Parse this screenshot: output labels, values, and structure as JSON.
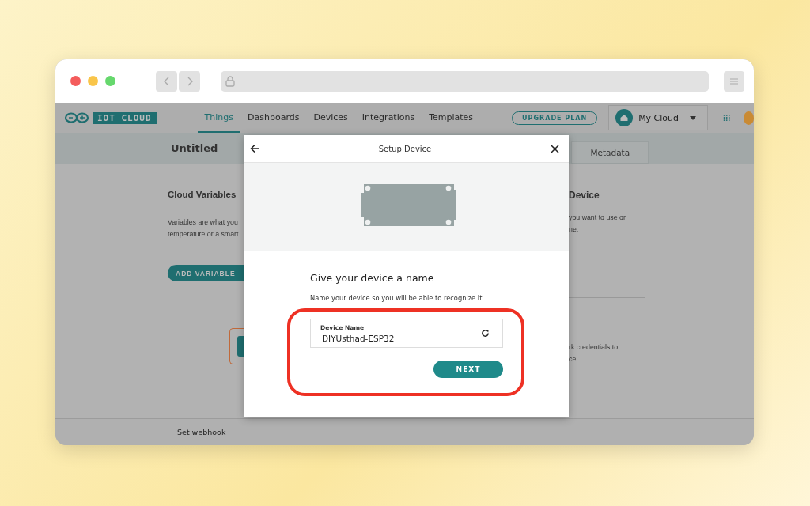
{
  "app_bar": {
    "logo_text": "IOT CLOUD",
    "nav": [
      {
        "label": "Things",
        "selected": true
      },
      {
        "label": "Dashboards",
        "selected": false
      },
      {
        "label": "Devices",
        "selected": false
      },
      {
        "label": "Integrations",
        "selected": false
      },
      {
        "label": "Templates",
        "selected": false
      }
    ],
    "upgrade_button": "UPGRADE PLAN",
    "space": "My Cloud"
  },
  "thing": {
    "title": "Untitled",
    "tab": "Metadata"
  },
  "left_section": {
    "title": "Cloud Variables",
    "lines": [
      "Variables are what you",
      "temperature or a smart"
    ],
    "button": "ADD VARIABLE"
  },
  "right_section": {
    "title": "Device",
    "lines": [
      "you want to use or",
      "ne."
    ],
    "lines_2": [
      "rk credentials to",
      "ce."
    ]
  },
  "footer": {
    "link": "Set webhook"
  },
  "dialog": {
    "title": "Setup Device",
    "heading": "Give your device a name",
    "description": "Name your device so you will be able to recognize it.",
    "field": {
      "label": "Device Name",
      "value": "DIYUsthad-ESP32"
    },
    "button": "NEXT"
  }
}
